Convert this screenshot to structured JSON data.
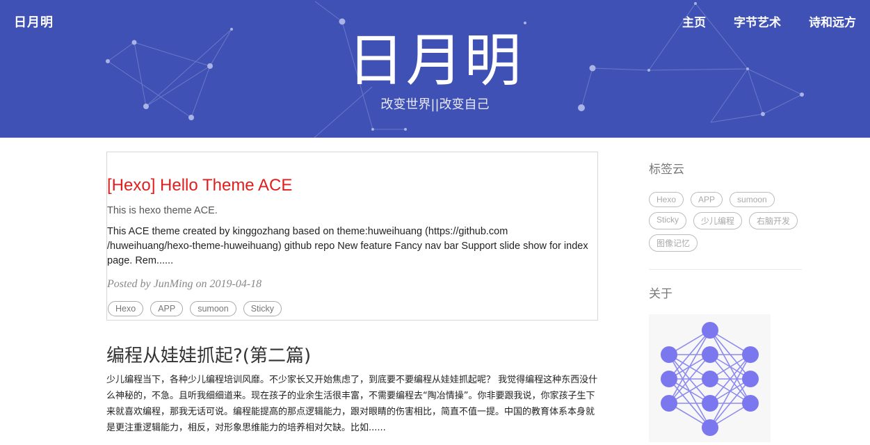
{
  "header": {
    "brand": "日月明",
    "nav": [
      "主页",
      "字节艺术",
      "诗和远方"
    ],
    "title": "日月明",
    "subtitle": "改变世界||改变自己",
    "bg_color": "#3f51b5"
  },
  "posts": [
    {
      "title": "[Hexo] Hello Theme ACE",
      "subtitle": "This is hexo theme ACE.",
      "excerpt": "This ACE theme created by kinggozhang based on theme:huweihuang (https://github.com /huweihuang/hexo-theme-huweihuang) github repo New feature Fancy nav bar Support slide show for index page. Rem......",
      "meta": "Posted by JunMing on 2019-04-18",
      "tags": [
        "Hexo",
        "APP",
        "sumoon",
        "Sticky"
      ],
      "title_color": "#e01e1e"
    },
    {
      "title": "编程从娃娃抓起?(第二篇)",
      "excerpt": "少儿编程当下，各种少儿编程培训风靡。不少家长又开始焦虑了，到底要不要编程从娃娃抓起呢？ 我觉得编程这种东西没什么神秘的，不急。且听我细细道来。现在孩子的业余生活很丰富，不需要编程去“陶冶情操”。你非要跟我说，你家孩子生下来就喜欢编程，那我无话可说。编程能提高的那点逻辑能力，跟对眼睛的伤害相比，简直不值一提。中国的教育体系本身就是更注重逻辑能力，相反，对形象思维能力的培养相对欠缺。比如......"
    }
  ],
  "sidebar": {
    "tagcloud_title": "标签云",
    "tags": [
      "Hexo",
      "APP",
      "sumoon",
      "Sticky",
      "少儿编程",
      "右脑开发",
      "图像记忆"
    ],
    "about_title": "关于",
    "about_image_icon": "neural-network-icon"
  }
}
